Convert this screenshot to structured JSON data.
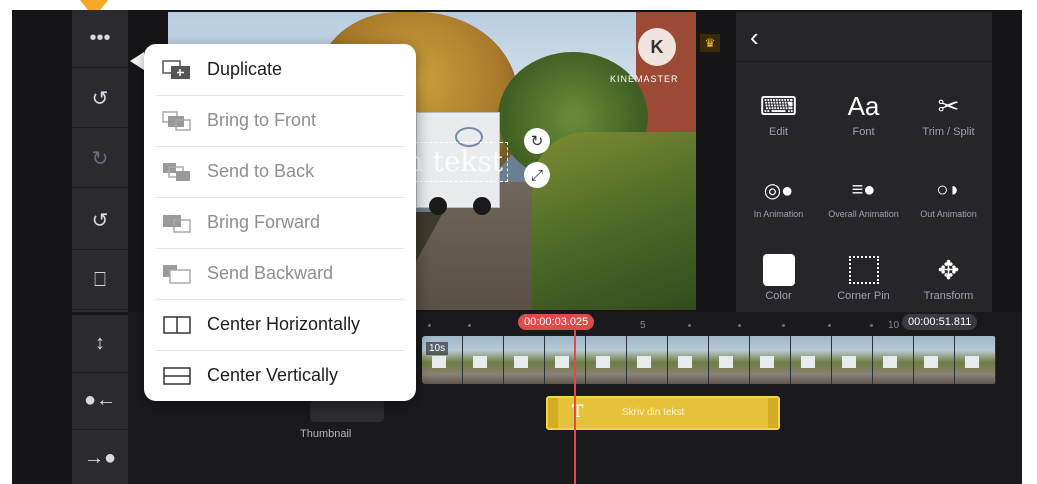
{
  "left_toolbar": {
    "items": [
      {
        "name": "more-icon",
        "glyph": "•••"
      },
      {
        "name": "undo-icon",
        "glyph": "↺"
      },
      {
        "name": "redo-icon",
        "glyph": "↻"
      },
      {
        "name": "restore-icon",
        "glyph": "↺"
      },
      {
        "name": "trash-icon",
        "glyph": "🗑"
      },
      {
        "name": "split-icon",
        "glyph": "⬍"
      },
      {
        "name": "move-in-icon",
        "glyph": "●←"
      },
      {
        "name": "move-out-icon",
        "glyph": "→●"
      }
    ]
  },
  "popup_menu": {
    "items": [
      {
        "label": "Duplicate",
        "icon": "duplicate-icon",
        "enabled": true
      },
      {
        "label": "Bring to Front",
        "icon": "bring-to-front-icon",
        "enabled": false
      },
      {
        "label": "Send to Back",
        "icon": "send-to-back-icon",
        "enabled": false
      },
      {
        "label": "Bring Forward",
        "icon": "bring-forward-icon",
        "enabled": false
      },
      {
        "label": "Send Backward",
        "icon": "send-backward-icon",
        "enabled": false
      },
      {
        "label": "Center Horizontally",
        "icon": "center-horizontally-icon",
        "enabled": true
      },
      {
        "label": "Center Vertically",
        "icon": "center-vertically-icon",
        "enabled": true
      }
    ]
  },
  "preview": {
    "text_layer": "din tekst",
    "watermark": "KINEMASTER",
    "logo_letter": "K"
  },
  "right_panel": {
    "items": [
      {
        "label": "Edit",
        "icon": "keyboard-icon"
      },
      {
        "label": "Font",
        "icon": "font-icon",
        "glyph": "Aa"
      },
      {
        "label": "Trim / Split",
        "icon": "scissors-icon"
      },
      {
        "label": "In Animation",
        "icon": "in-animation-icon"
      },
      {
        "label": "Overall Animation",
        "icon": "overall-animation-icon"
      },
      {
        "label": "Out Animation",
        "icon": "out-animation-icon"
      },
      {
        "label": "Color",
        "icon": "color-swatch-icon"
      },
      {
        "label": "Corner Pin",
        "icon": "corner-pin-icon"
      },
      {
        "label": "Transform",
        "icon": "transform-icon"
      }
    ]
  },
  "timeline": {
    "playhead_time": "00:00:03.025",
    "end_time": "00:00:51.811",
    "ruler_5": "5",
    "ruler_10": "10",
    "clip_badge": "10s",
    "text_clip_label": "Skriv din tekst",
    "thumbnail_label": "Thumbnail"
  },
  "colors": {
    "accent": "#e14a4a",
    "text_clip": "#e6c23a",
    "marker": "#f5a823"
  }
}
